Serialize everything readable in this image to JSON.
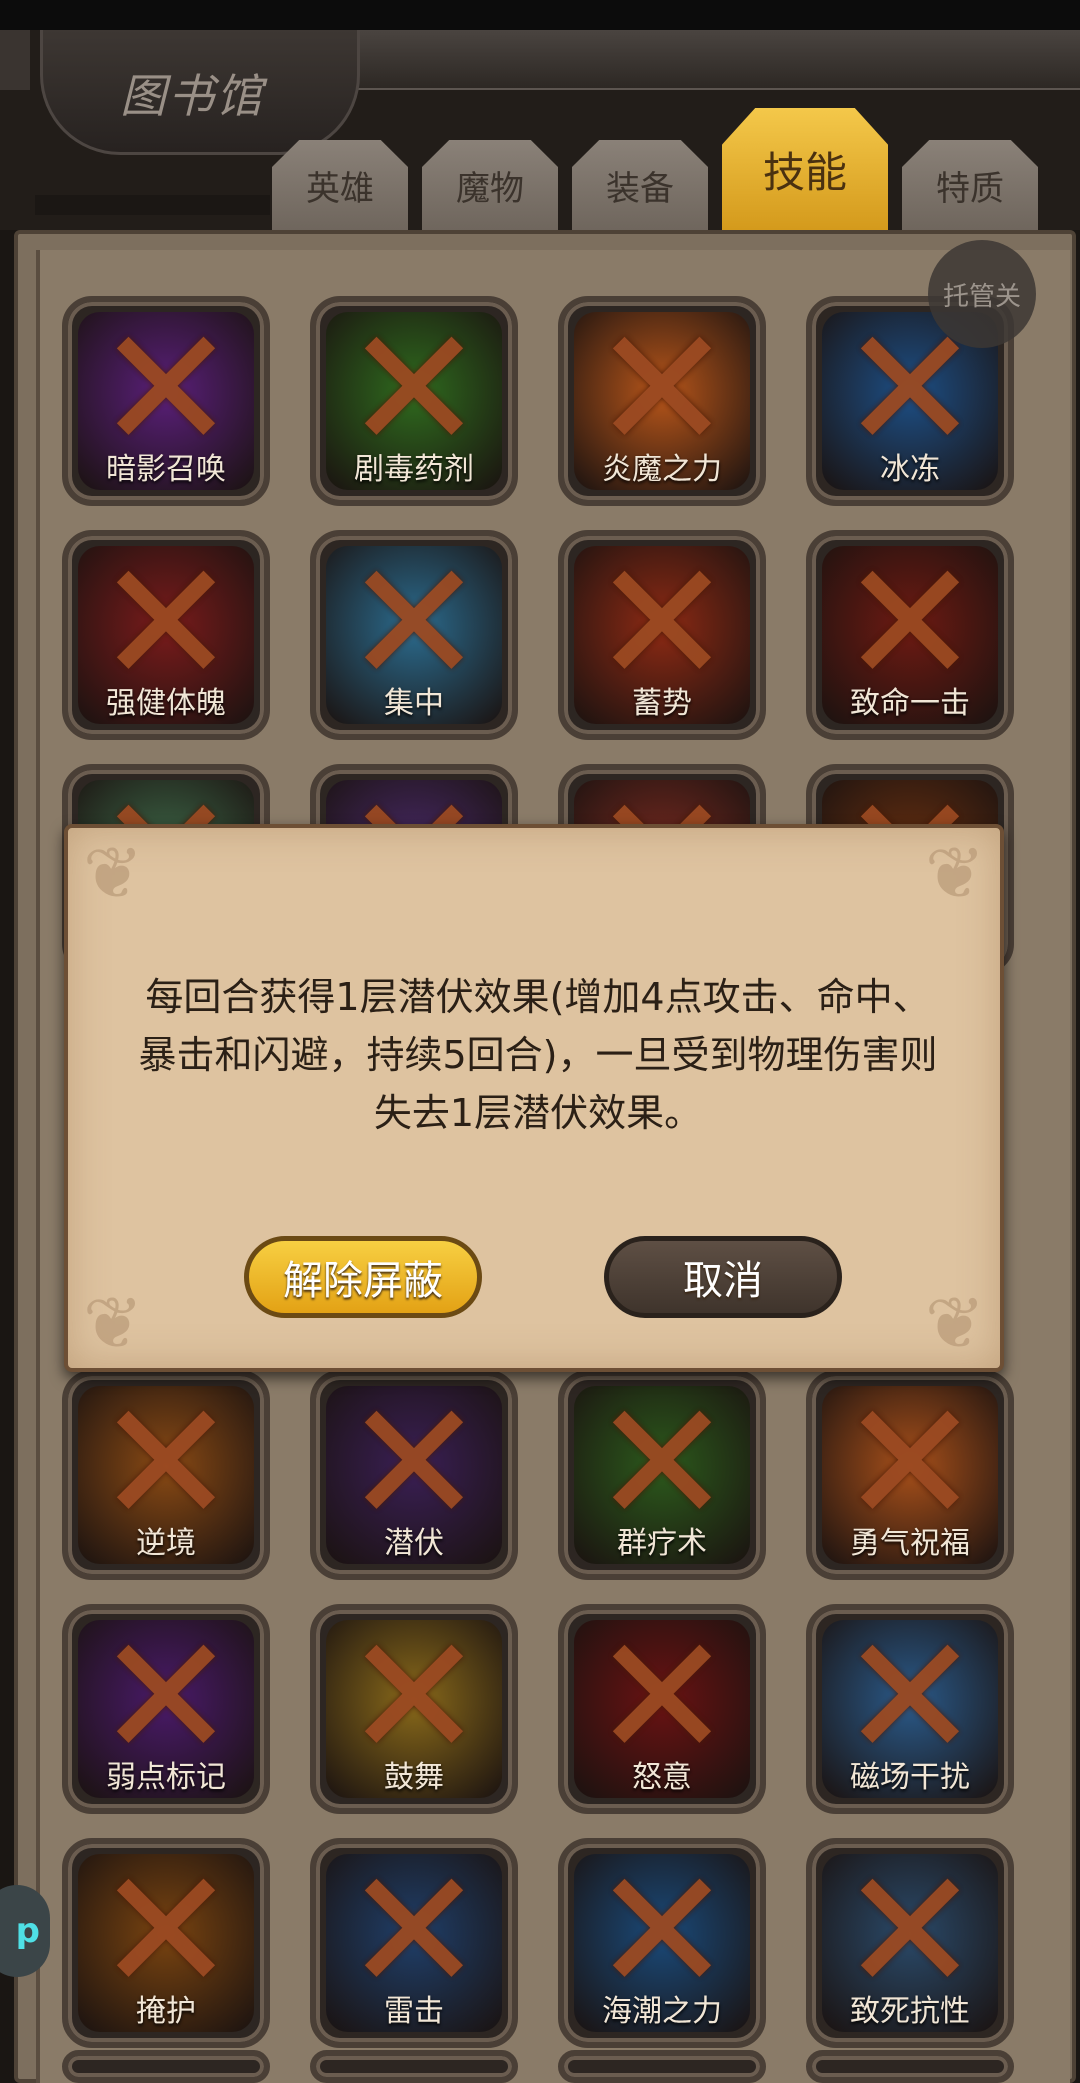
{
  "header": {
    "title": "图书馆"
  },
  "tabs": [
    {
      "label": "英雄"
    },
    {
      "label": "魔物"
    },
    {
      "label": "装备"
    },
    {
      "label": "技能",
      "active": true
    },
    {
      "label": "特质"
    }
  ],
  "toggle_button": "托管关",
  "side_app": "p",
  "skills": [
    {
      "name": "暗影召唤",
      "color": "#5a1f7a"
    },
    {
      "name": "剧毒药剂",
      "color": "#2f6b1e"
    },
    {
      "name": "炎魔之力",
      "color": "#b8561a"
    },
    {
      "name": "冰冻",
      "color": "#1d4f86"
    },
    {
      "name": "强健体魄",
      "color": "#7a1b1b"
    },
    {
      "name": "集中",
      "color": "#2b6c8f"
    },
    {
      "name": "蓄势",
      "color": "#8e2a14"
    },
    {
      "name": "致命一击",
      "color": "#6e1a12"
    },
    {
      "name": "",
      "color": "#3f6b4a"
    },
    {
      "name": "",
      "color": "#4a2a6a"
    },
    {
      "name": "",
      "color": "#7a2a20"
    },
    {
      "name": "",
      "color": "#6a3010"
    },
    {
      "name": "逆境",
      "color": "#8a4a14"
    },
    {
      "name": "潜伏",
      "color": "#3a1f55"
    },
    {
      "name": "群疗术",
      "color": "#2c5a1c"
    },
    {
      "name": "勇气祝福",
      "color": "#a8501a"
    },
    {
      "name": "弱点标记",
      "color": "#4a1a6a"
    },
    {
      "name": "鼓舞",
      "color": "#8a6a1a"
    },
    {
      "name": "怒意",
      "color": "#6a1212"
    },
    {
      "name": "磁场干扰",
      "color": "#2a5a8a"
    },
    {
      "name": "掩护",
      "color": "#7a4410"
    },
    {
      "name": "雷击",
      "color": "#1f3f6a"
    },
    {
      "name": "海潮之力",
      "color": "#1a4a7a"
    },
    {
      "name": "致死抗性",
      "color": "#2a4a6a"
    }
  ],
  "dialog": {
    "text": "每回合获得1层潜伏效果(增加4点攻击、命中、暴击和闪避，持续5回合)，一旦受到物理伤害则失去1层潜伏效果。",
    "confirm_label": "解除屏蔽",
    "cancel_label": "取消"
  }
}
